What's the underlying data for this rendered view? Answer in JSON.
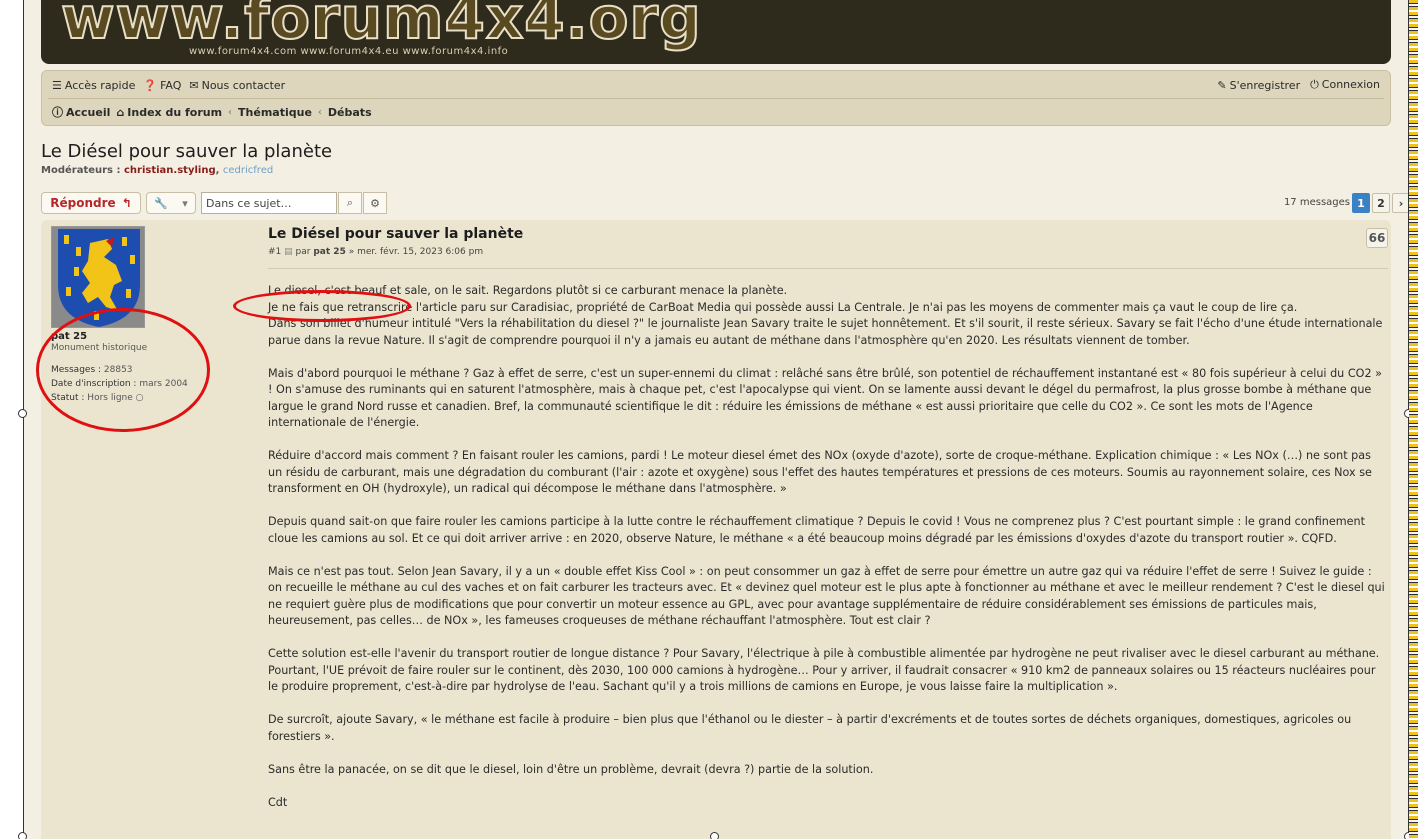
{
  "logo": {
    "text": "www.forum4x4.org",
    "sub": "www.forum4x4.com www.forum4x4.eu www.forum4x4.info"
  },
  "navbar": {
    "quick": "Accès rapide",
    "faq": "FAQ",
    "contact": "Nous contacter",
    "register": "S'enregistrer",
    "login": "Connexion",
    "breadcrumbs": [
      "Accueil",
      "Index du forum",
      "Thématique",
      "Débats"
    ]
  },
  "topic": {
    "title": "Le Diésel pour sauver la planète",
    "moderators_label": "Modérateurs :",
    "moderator1": "christian.styling",
    "moderator2": "cedricfred"
  },
  "actions": {
    "reply": "Répondre",
    "search_placeholder": "Dans ce sujet…",
    "message_count": "17 messages",
    "pages": [
      "1",
      "2"
    ]
  },
  "post": {
    "author": "pat 25",
    "rank": "Monument historique",
    "messages_label": "Messages :",
    "messages_value": "28853",
    "joined_label": "Date d'inscription :",
    "joined_value": "mars 2004",
    "status_label": "Statut :",
    "status_value": "Hors ligne",
    "title": "Le Diésel pour sauver la planète",
    "number": "#1",
    "by": "par",
    "date": "» mer. févr. 15, 2023 6:06 pm",
    "quote_icon": "66",
    "paragraphs": [
      "Le diesel, c'est beauf et sale, on le sait. Regardons plutôt si ce carburant menace la planète.\nJe ne fais que retranscrire l'article paru sur Caradisiac, propriété de CarBoat Media qui possède aussi La Centrale. Je n'ai pas les moyens de commenter mais ça vaut le coup de lire ça.\nDans son billet d'humeur intitulé \"Vers la réhabilitation du diesel ?\" le journaliste Jean Savary traite le sujet honnêtement. Et s'il sourit, il reste sérieux. Savary se fait l'écho d'une étude internationale parue dans la revue Nature. Il s'agit de comprendre pourquoi il n'y a jamais eu autant de méthane dans l'atmosphère qu'en 2020. Les résultats viennent de tomber.",
      "Mais d'abord pourquoi le méthane ? Gaz à effet de serre, c'est un super-ennemi du climat : relâché sans être brûlé, son potentiel de réchauffement instantané est « 80 fois supérieur à celui du CO2 » ! On s'amuse des ruminants qui en saturent l'atmosphère, mais à chaque pet, c'est l'apocalypse qui vient. On se lamente aussi devant le dégel du permafrost, la plus grosse bombe à méthane que largue le grand Nord russe et canadien. Bref, la communauté scientifique le dit : réduire les émissions de méthane « est aussi prioritaire que celle du CO2 ». Ce sont les mots de l'Agence internationale de l'énergie.",
      "Réduire d'accord mais comment ? En faisant rouler les camions, pardi ! Le moteur diesel émet des NOx (oxyde d'azote), sorte de croque-méthane. Explication chimique : « Les NOx (…) ne sont pas un résidu de carburant, mais une dégradation du comburant (l'air : azote et oxygène) sous l'effet des hautes températures et pressions de ces moteurs. Soumis au rayonnement solaire, ces Nox se transforment en OH (hydroxyle), un radical qui décompose le méthane dans l'atmosphère. »",
      "Depuis quand sait-on que faire rouler les camions participe à la lutte contre le réchauffement climatique ? Depuis le covid ! Vous ne comprenez plus ? C'est pourtant simple : le grand confinement cloue les camions au sol. Et ce qui doit arriver arrive : en 2020, observe Nature, le méthane « a été beaucoup moins dégradé par les émissions d'oxydes d'azote du transport routier ». CQFD.",
      "Mais ce n'est pas tout. Selon Jean Savary, il y a un « double effet Kiss Cool » : on peut consommer un gaz à effet de serre pour émettre un autre gaz qui va réduire l'effet de serre ! Suivez le guide : on recueille le méthane au cul des vaches et on fait carburer les tracteurs avec. Et « devinez quel moteur est le plus apte à fonctionner au méthane et avec le meilleur rendement ? C'est le diesel qui ne requiert guère plus de modifications que pour convertir un moteur essence au GPL, avec pour avantage supplémentaire de réduire considérablement ses émissions de particules mais, heureusement, pas celles… de NOx », les fameuses croqueuses de méthane réchauffant l'atmosphère. Tout est clair ?",
      "Cette solution est-elle l'avenir du transport routier de longue distance ? Pour Savary, l'électrique à pile à combustible alimentée par hydrogène ne peut rivaliser avec le diesel carburant au méthane. Pourtant, l'UE prévoit de faire rouler sur le continent, dès 2030, 100 000 camions à hydrogène… Pour y arriver, il faudrait consacrer « 910 km2 de panneaux solaires ou 15 réacteurs nucléaires pour le produire proprement, c'est-à-dire par hydrolyse de l'eau. Sachant qu'il y a trois millions de camions en Europe, je vous laisse faire la multiplication ».",
      "De surcroît, ajoute Savary, « le méthane est facile à produire – bien plus que l'éthanol ou le diester – à partir d'excréments et de toutes sortes de déchets organiques, domestiques, agricoles ou forestiers ».",
      "Sans être la panacée, on se dit que le diesel, loin d'être un problème, devrait (devra ?) partie de la solution.",
      "Cdt"
    ]
  }
}
